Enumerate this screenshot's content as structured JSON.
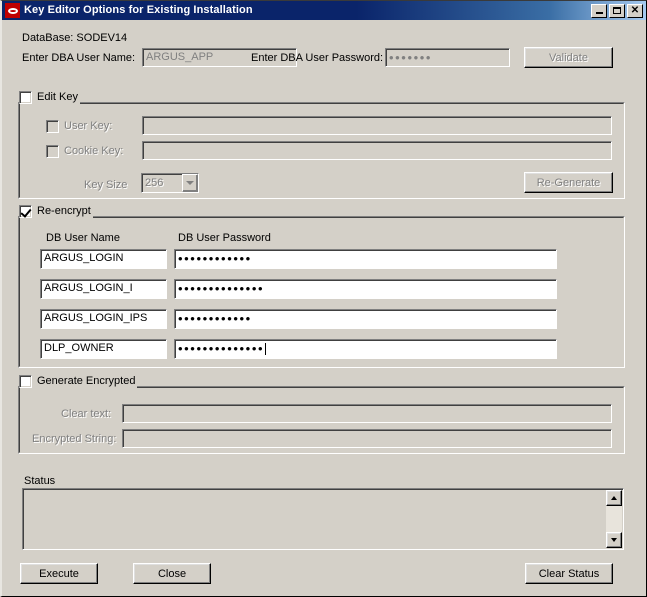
{
  "window": {
    "title": "Key Editor Options for Existing Installation",
    "icon": "oracle-logo-icon",
    "minimize_label": "",
    "maximize_label": "",
    "close_label": "✕"
  },
  "header": {
    "database_label": "DataBase: SODEV14",
    "dba_user_name_label": "Enter DBA User Name:",
    "dba_user_name_value": "ARGUS_APP",
    "dba_user_password_label": "Enter DBA User Password:",
    "dba_user_password_value": "•••••••",
    "validate_button": "Validate"
  },
  "edit_key": {
    "checkbox_label": "Edit Key",
    "checked": false,
    "user_key_label": "User Key:",
    "user_key_value": "",
    "cookie_key_label": "Cookie Key:",
    "cookie_key_value": "",
    "key_size_label": "Key Size",
    "key_size_value": "256",
    "key_size_options": [
      "256"
    ],
    "regenerate_button": "Re-Generate"
  },
  "re_encrypt": {
    "checkbox_label": "Re-encrypt",
    "checked": true,
    "col_user_name": "DB User Name",
    "col_user_password": "DB User Password",
    "rows": [
      {
        "user": "ARGUS_LOGIN",
        "password": "••••••••••••"
      },
      {
        "user": "ARGUS_LOGIN_I",
        "password": "••••••••••••••"
      },
      {
        "user": "ARGUS_LOGIN_IPS",
        "password": "••••••••••••"
      },
      {
        "user": "DLP_OWNER",
        "password": "••••••••••••••"
      }
    ]
  },
  "generate_encrypted": {
    "checkbox_label": "Generate Encrypted",
    "checked": false,
    "clear_text_label": "Clear text:",
    "clear_text_value": "",
    "encrypted_string_label": "Encrypted String:",
    "encrypted_string_value": ""
  },
  "status": {
    "label": "Status",
    "text": ""
  },
  "footer": {
    "execute_button": "Execute",
    "close_button": "Close",
    "clear_status_button": "Clear Status"
  },
  "colors": {
    "face": "#d4d0c8",
    "title_active": "#0a246a",
    "title_gradient_end": "#a6caf0",
    "disabled_text": "#808080",
    "field_bg": "#ffffff",
    "icon_red": "#c00000"
  }
}
